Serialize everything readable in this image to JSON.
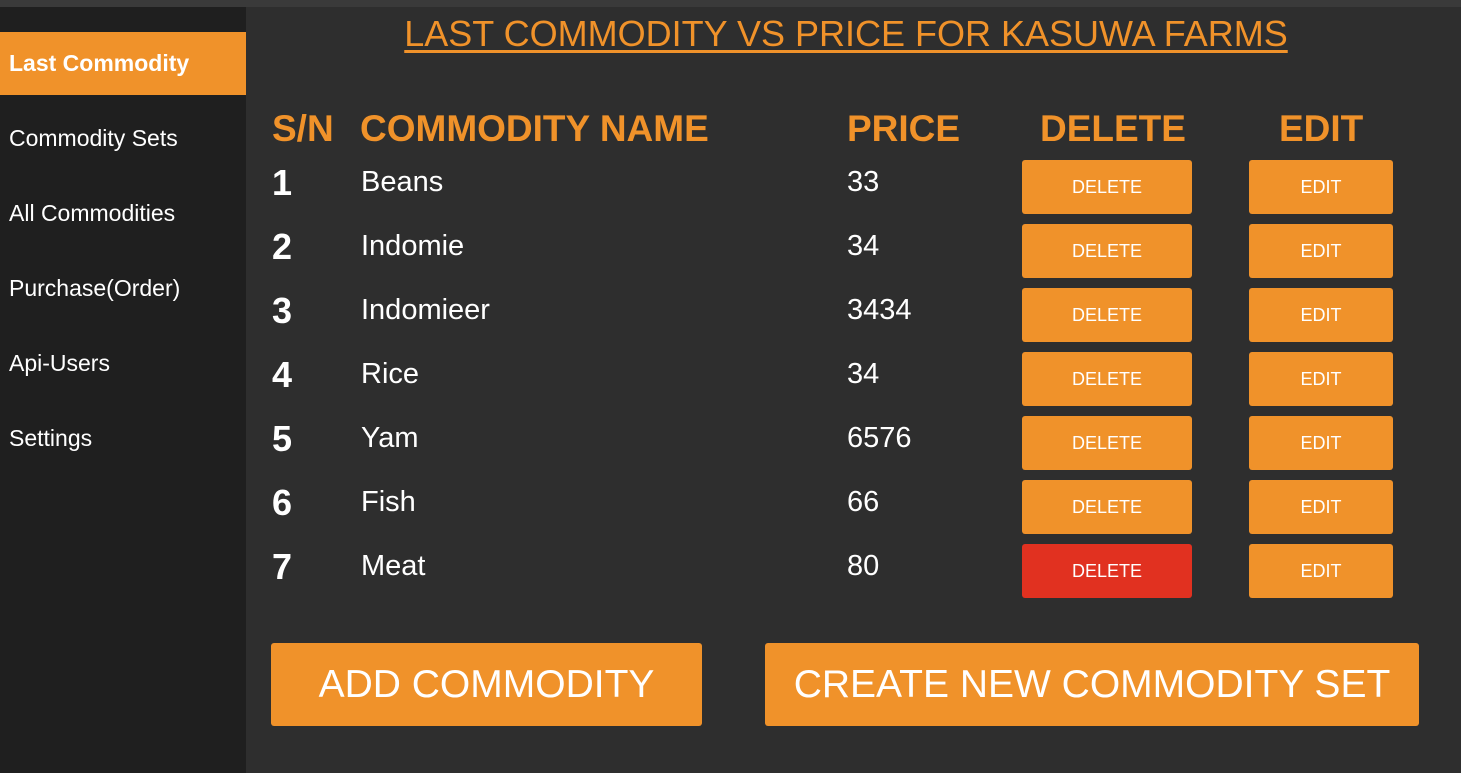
{
  "sidebar": {
    "items": [
      {
        "label": "Last Commodity"
      },
      {
        "label": "Commodity Sets"
      },
      {
        "label": "All Commodities"
      },
      {
        "label": "Purchase(Order)"
      },
      {
        "label": "Api-Users"
      },
      {
        "label": "Settings"
      }
    ]
  },
  "main": {
    "title": "LAST COMMODITY VS PRICE FOR KASUWA FARMS",
    "headers": {
      "sn": "S/N",
      "name": "COMMODITY NAME",
      "price": "PRICE",
      "delete": "DELETE",
      "edit": "EDIT"
    },
    "rows": [
      {
        "sn": "1",
        "name": "Beans",
        "price": "33",
        "delete_label": "DELETE",
        "edit_label": "EDIT"
      },
      {
        "sn": "2",
        "name": "Indomie",
        "price": "34",
        "delete_label": "DELETE",
        "edit_label": "EDIT"
      },
      {
        "sn": "3",
        "name": "Indomieer",
        "price": "3434",
        "delete_label": "DELETE",
        "edit_label": "EDIT"
      },
      {
        "sn": "4",
        "name": "Rice",
        "price": "34",
        "delete_label": "DELETE",
        "edit_label": "EDIT"
      },
      {
        "sn": "5",
        "name": "Yam",
        "price": "6576",
        "delete_label": "DELETE",
        "edit_label": "EDIT"
      },
      {
        "sn": "6",
        "name": "Fish",
        "price": "66",
        "delete_label": "DELETE",
        "edit_label": "EDIT"
      },
      {
        "sn": "7",
        "name": "Meat",
        "price": "80",
        "delete_label": "DELETE",
        "edit_label": "EDIT"
      }
    ],
    "add_button": "ADD COMMODITY",
    "create_set_button": "CREATE NEW COMMODITY SET"
  },
  "colors": {
    "accent": "#f0922a",
    "danger": "#e13120",
    "sidebar_bg": "#1f1f1f",
    "main_bg": "#2e2e2e"
  }
}
